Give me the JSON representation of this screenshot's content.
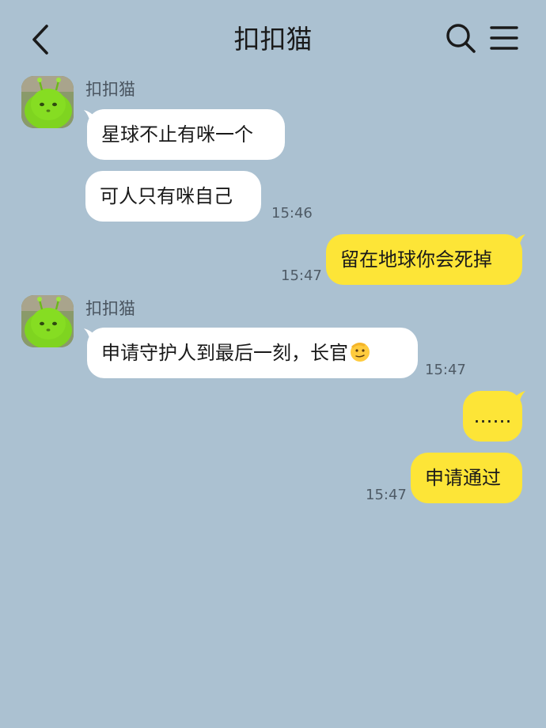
{
  "header": {
    "title": "扣扣猫",
    "back_icon": "chevron-left-icon",
    "search_icon": "search-icon",
    "menu_icon": "hamburger-menu-icon"
  },
  "colors": {
    "background": "#abc1d1",
    "incoming_bubble": "#ffffff",
    "outgoing_bubble": "#fde537"
  },
  "messages": [
    {
      "sender": "扣扣猫",
      "direction": "incoming",
      "text": "星球不止有咪一个"
    },
    {
      "direction": "incoming",
      "text": "可人只有咪自己",
      "time": "15:46"
    },
    {
      "direction": "outgoing",
      "text": "留在地球你会死掉",
      "time": "15:47"
    },
    {
      "sender": "扣扣猫",
      "direction": "incoming",
      "text": "申请守护人到最后一刻，长官",
      "emoji": "saluting-face",
      "time": "15:47"
    },
    {
      "direction": "outgoing",
      "text": "……"
    },
    {
      "direction": "outgoing",
      "text": "申请通过",
      "time": "15:47"
    }
  ]
}
